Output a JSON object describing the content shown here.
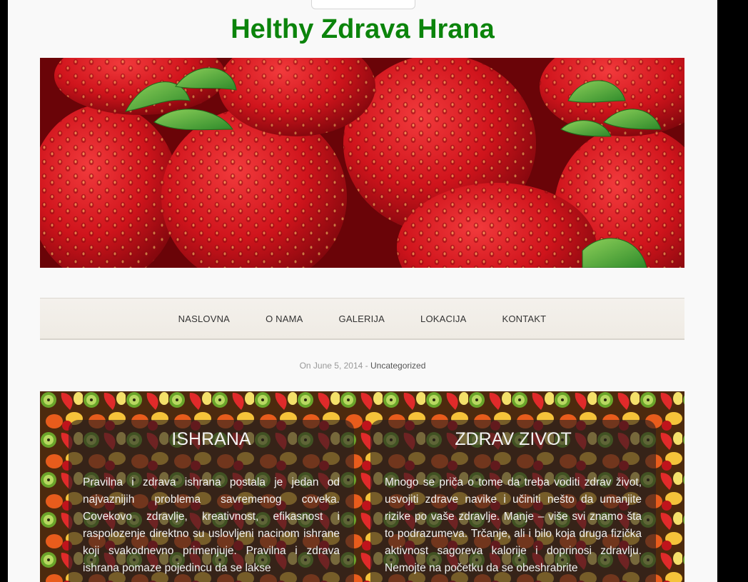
{
  "site": {
    "title": "Helthy Zdrava Hrana"
  },
  "nav": {
    "items": [
      {
        "label": "NASLOVNA"
      },
      {
        "label": "O NAMA"
      },
      {
        "label": "GALERIJA"
      },
      {
        "label": "LOKACIJA"
      },
      {
        "label": "KONTAKT"
      }
    ]
  },
  "post_meta": {
    "date_text": "On June 5, 2014 -",
    "category": "Uncategorized"
  },
  "panels": {
    "left": {
      "title": "ISHRANA",
      "text": "Pravilna i zdrava ishrana postala je jedan od najvaznijih problema savremenog coveka. Covekovo zdravlje, kreativnost, efikasnost i raspolozenje direktno su uslovljeni nacinom ishrane koji svakodnevno primenjuje. Pravilna i zdrava ishrana pomaze pojedincu da se lakse"
    },
    "right": {
      "title": "ZDRAV ZIVOT",
      "text": "Mnogo se priča o tome da treba voditi zdrav život, usvojiti zdrave navike i učiniti nešto da umanjite rizike po vaše zdravlje. Manje – više svi znamo šta to podrazumeva. Trčanje, ali i bilo koja druga fizička aktivnost sagoreva kalorije i doprinosi zdravlju. Nemojte na početku da se obeshrabrite"
    }
  },
  "colors": {
    "title_green": "#0b840b",
    "page_bg": "#f9f9f9",
    "nav_bg": "#f4f1ec",
    "strawberry_red": "#c8141e"
  },
  "images": {
    "hero": "strawberries-photo",
    "section_bg": "mixed-fruit-photo"
  }
}
